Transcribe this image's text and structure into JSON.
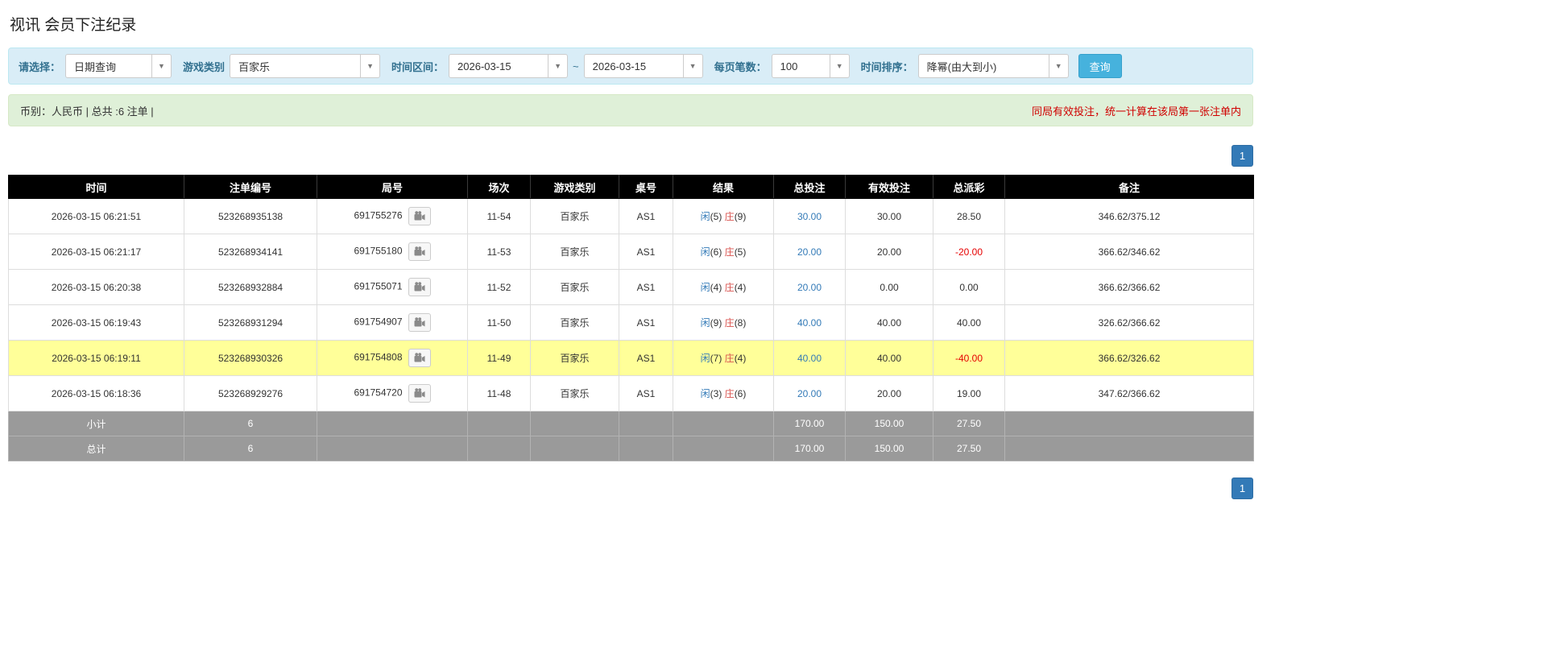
{
  "page": {
    "title": "视讯 会员下注纪录"
  },
  "filters": {
    "select_label": "请选择：",
    "select_value": "日期查询",
    "game_label": "游戏类别",
    "game_value": "百家乐",
    "range_label": "时间区间：",
    "date_from": "2026-03-15",
    "tilde": "~",
    "date_to": "2026-03-15",
    "per_page_label": "每页笔数：",
    "per_page_value": "100",
    "sort_label": "时间排序：",
    "sort_value": "降幂(由大到小)",
    "search_button": "查询",
    "caret_icon": "▼"
  },
  "summary": {
    "left": "币别：人民币 | 总共 :6 注单 |",
    "right": "同局有效投注，统一计算在该局第一张注单内"
  },
  "pagination": {
    "page": "1"
  },
  "table": {
    "headers": [
      "时间",
      "注单编号",
      "局号",
      "场次",
      "游戏类别",
      "桌号",
      "结果",
      "总投注",
      "有效投注",
      "总派彩",
      "备注"
    ],
    "rows": [
      {
        "time": "2026-03-15 06:21:51",
        "bet_id": "523268935138",
        "round": "691755276",
        "session": "11-54",
        "game": "百家乐",
        "table_no": "AS1",
        "result": {
          "player": "闲",
          "player_score": "5",
          "banker": "庄",
          "banker_score": "9"
        },
        "total_bet": "30.00",
        "valid_bet": "30.00",
        "payout": "28.50",
        "note": "346.62/375.12",
        "highlight": false
      },
      {
        "time": "2026-03-15 06:21:17",
        "bet_id": "523268934141",
        "round": "691755180",
        "session": "11-53",
        "game": "百家乐",
        "table_no": "AS1",
        "result": {
          "player": "闲",
          "player_score": "6",
          "banker": "庄",
          "banker_score": "5"
        },
        "total_bet": "20.00",
        "valid_bet": "20.00",
        "payout": "-20.00",
        "note": "366.62/346.62",
        "highlight": false
      },
      {
        "time": "2026-03-15 06:20:38",
        "bet_id": "523268932884",
        "round": "691755071",
        "session": "11-52",
        "game": "百家乐",
        "table_no": "AS1",
        "result": {
          "player": "闲",
          "player_score": "4",
          "banker": "庄",
          "banker_score": "4"
        },
        "total_bet": "20.00",
        "valid_bet": "0.00",
        "payout": "0.00",
        "note": "366.62/366.62",
        "highlight": false
      },
      {
        "time": "2026-03-15 06:19:43",
        "bet_id": "523268931294",
        "round": "691754907",
        "session": "11-50",
        "game": "百家乐",
        "table_no": "AS1",
        "result": {
          "player": "闲",
          "player_score": "9",
          "banker": "庄",
          "banker_score": "8"
        },
        "total_bet": "40.00",
        "valid_bet": "40.00",
        "payout": "40.00",
        "note": "326.62/366.62",
        "highlight": false
      },
      {
        "time": "2026-03-15 06:19:11",
        "bet_id": "523268930326",
        "round": "691754808",
        "session": "11-49",
        "game": "百家乐",
        "table_no": "AS1",
        "result": {
          "player": "闲",
          "player_score": "7",
          "banker": "庄",
          "banker_score": "4"
        },
        "total_bet": "40.00",
        "valid_bet": "40.00",
        "payout": "-40.00",
        "note": "366.62/326.62",
        "highlight": true
      },
      {
        "time": "2026-03-15 06:18:36",
        "bet_id": "523268929276",
        "round": "691754720",
        "session": "11-48",
        "game": "百家乐",
        "table_no": "AS1",
        "result": {
          "player": "闲",
          "player_score": "3",
          "banker": "庄",
          "banker_score": "6"
        },
        "total_bet": "20.00",
        "valid_bet": "20.00",
        "payout": "19.00",
        "note": "347.62/366.62",
        "highlight": false
      }
    ],
    "footer_rows": [
      {
        "label": "小计",
        "count": "6",
        "total_bet": "170.00",
        "valid_bet": "150.00",
        "payout": "27.50"
      },
      {
        "label": "总计",
        "count": "6",
        "total_bet": "170.00",
        "valid_bet": "150.00",
        "payout": "27.50"
      }
    ]
  },
  "colors": {
    "accent_blue": "#337ab7",
    "result_player_blue": "#337ab7",
    "result_banker_red": "#d9534f",
    "negative_red": "#e60000",
    "highlight_yellow": "#ffff99",
    "filter_bar_bg": "#d9edf7",
    "summary_bar_bg": "#dff0d8",
    "header_bg": "#000000",
    "footer_row_bg": "#9a9a9a"
  }
}
